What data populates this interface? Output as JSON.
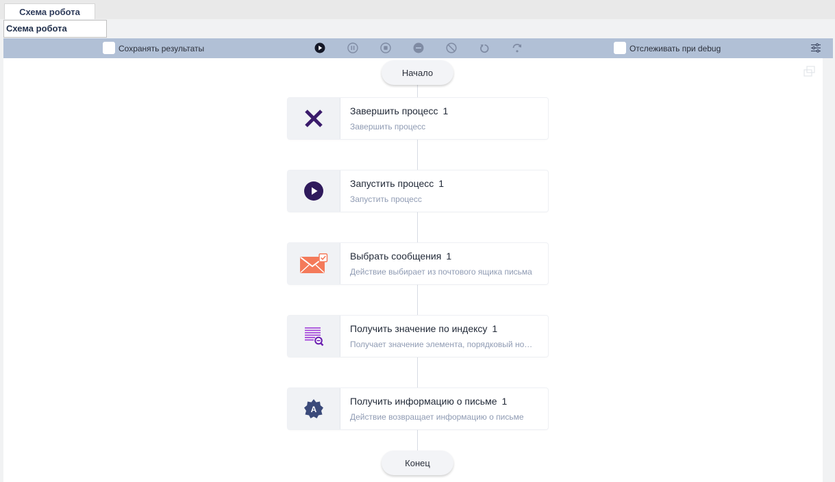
{
  "tab": {
    "label": "Схема робота"
  },
  "name_field": {
    "value": "Схема робота"
  },
  "toolbar": {
    "save_results_label": "Сохранять результаты",
    "save_results_checked": false,
    "track_debug_label": "Отслеживать при debug",
    "track_debug_checked": false,
    "controls": [
      "play-icon",
      "pause-icon",
      "stop-icon",
      "minus-circle-icon",
      "cancel-icon",
      "rotate-left-icon",
      "step-over-icon",
      "settings-sliders-icon"
    ]
  },
  "flow": {
    "start_label": "Начало",
    "end_label": "Конец",
    "steps": [
      {
        "title": "Завершить процесс",
        "count": "1",
        "subtitle": "Завершить процесс",
        "icon": "close-x-icon",
        "color": "#3a1b6b"
      },
      {
        "title": "Запустить процесс",
        "count": "1",
        "subtitle": "Запустить процесс",
        "icon": "play-circle-icon",
        "color": "#2f1a5c"
      },
      {
        "title": "Выбрать сообщения",
        "count": "1",
        "subtitle": "Действие выбирает из почтового ящика письма",
        "icon": "mail-check-icon",
        "color": "#f47a5a"
      },
      {
        "title": "Получить значение по индексу",
        "count": "1",
        "subtitle": "Получает значение элемента, порядковый номер",
        "icon": "list-search-icon",
        "color": "#9b2fd6"
      },
      {
        "title": "Получить информацию о письме",
        "count": "1",
        "subtitle": "Действие возвращает информацию о письме",
        "icon": "badge-a-icon",
        "color": "#3b4a7a"
      }
    ]
  }
}
